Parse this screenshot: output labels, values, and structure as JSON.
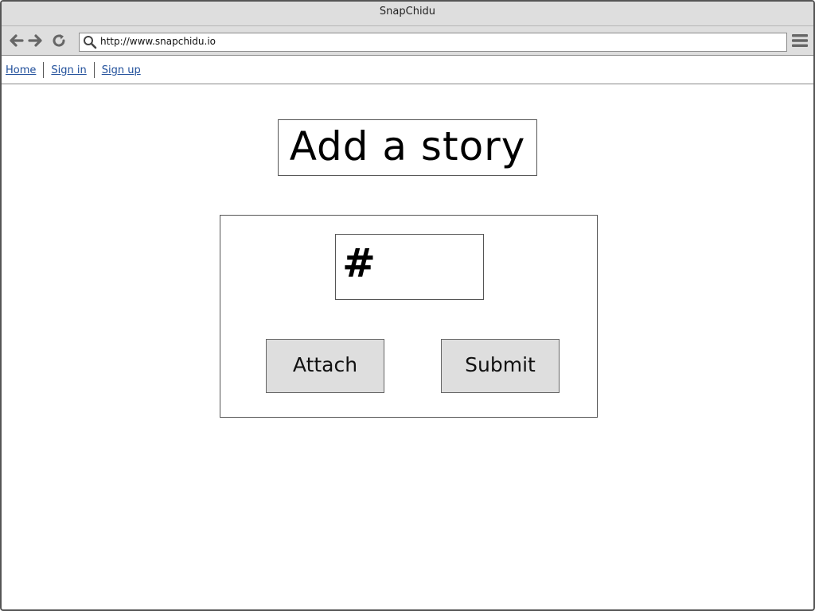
{
  "window": {
    "title": "SnapChidu"
  },
  "toolbar": {
    "url": "http://www.snapchidu.io",
    "icons": [
      "back-arrow-icon",
      "forward-arrow-icon",
      "reload-icon",
      "search-icon",
      "hamburger-menu-icon"
    ]
  },
  "nav_links": {
    "home": "Home",
    "sign_in": "Sign in",
    "sign_up": "Sign up"
  },
  "page": {
    "title": "Add a story"
  },
  "form": {
    "hashtag_value": "#",
    "attach_label": "Attach",
    "submit_label": "Submit"
  },
  "colors": {
    "chrome_bg": "#dedede",
    "border": "#555555",
    "link": "#1f4e9a",
    "button_bg": "#dedede"
  }
}
